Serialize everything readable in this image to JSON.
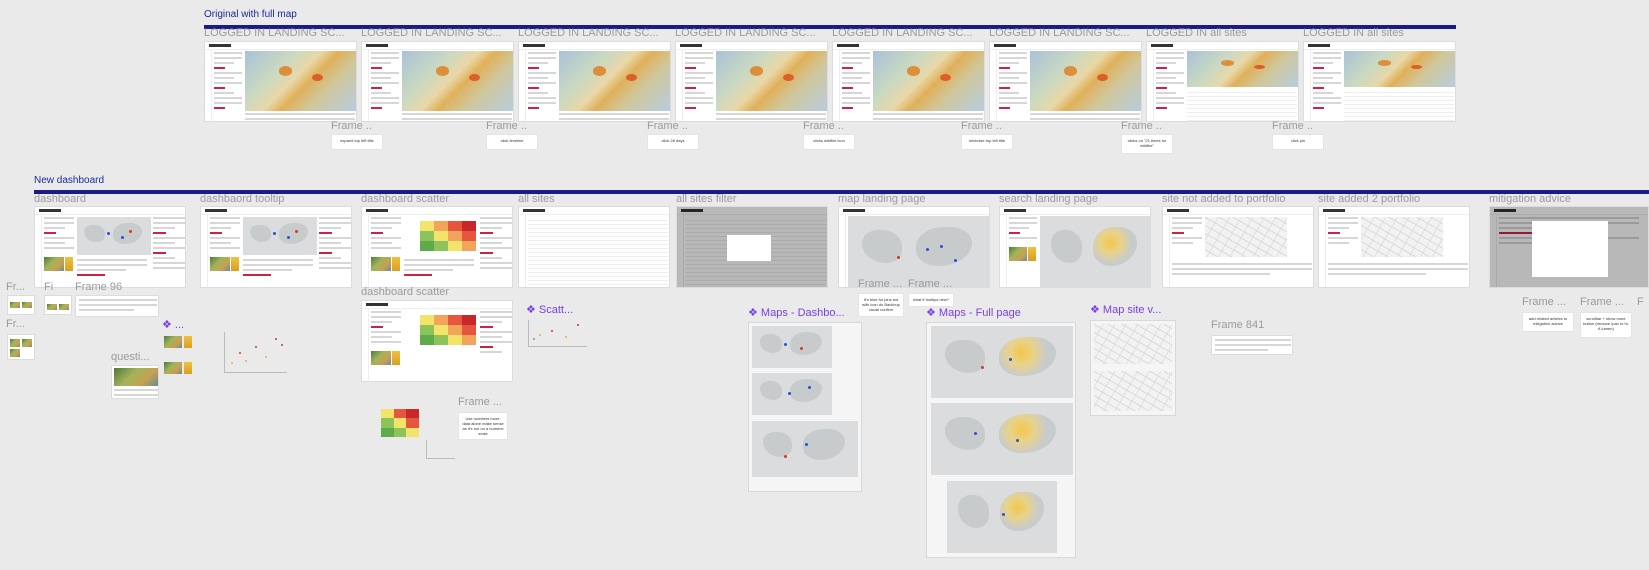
{
  "sections": {
    "original": "Original with full map",
    "new": "New dashboard"
  },
  "original_frames": [
    "LOGGED IN  LANDING SC...",
    "LOGGED IN  LANDING SC...",
    "LOGGED IN  LANDING SC...",
    "LOGGED IN  LANDING SC...",
    "LOGGED IN  LANDING SC...",
    "LOGGED IN  LANDING SC...",
    "LOGGED IN  all sites",
    "LOGGED IN  all sites"
  ],
  "original_frame_small": [
    "Frame ...",
    "Frame ...",
    "Frame ...",
    "Frame ...",
    "Frame ...",
    "Frame ...",
    "Frame ..."
  ],
  "original_notes": [
    "expand top left title",
    "click timeline",
    "click 28 days",
    "clicks wildfire icon",
    "minimise top left title",
    "clicks on \"21 times for wildfire\"",
    "click pin"
  ],
  "new_frames": [
    "dashboard",
    "dashbaord tooltip",
    "dashboard scatter",
    "all sites",
    "all sites filter",
    "map landing page",
    "search landing page",
    "site not added to portfolio",
    "site added 2 portfolio",
    "mitigation advice"
  ],
  "misc_labels": {
    "fr1": "Fr...",
    "fr2": "Fr...",
    "frame96": "Frame 96",
    "fi": "Fi",
    "question": "questi...",
    "dashboard_scatter2": "dashboard scatter",
    "frame_a": "Frame ...",
    "frame_b": "Frame ...",
    "frame_c": "Frame ...",
    "frame841": "Frame 841",
    "frame_d": "Frame ...",
    "frame_e": "Frame ...",
    "frame_f": "F"
  },
  "components": {
    "scatt": "❖ Scatt...",
    "maps_dashboard": "❖ Maps - Dashbo...",
    "maps_full": "❖ Maps - Full page",
    "map_site": "❖ Map site v...",
    "dots": "❖ ..."
  },
  "new_notes": {
    "pins": "It's blue for pins but with icon do Backhup visual confirm",
    "tooltip": "what if tooltips new?",
    "numbers": "Use numbers more, data alone make sense as it's not on a numeric scale",
    "advice": "add related articles to mitigation advice",
    "scrollbar": "scrollbar + show more button (remove /pan to hi-fi-lumen)"
  },
  "colors": {
    "title": "#1a2a9c",
    "bar": "#1b1b86",
    "component": "#7b3fe4",
    "frame_label": "#9b9b9b"
  }
}
